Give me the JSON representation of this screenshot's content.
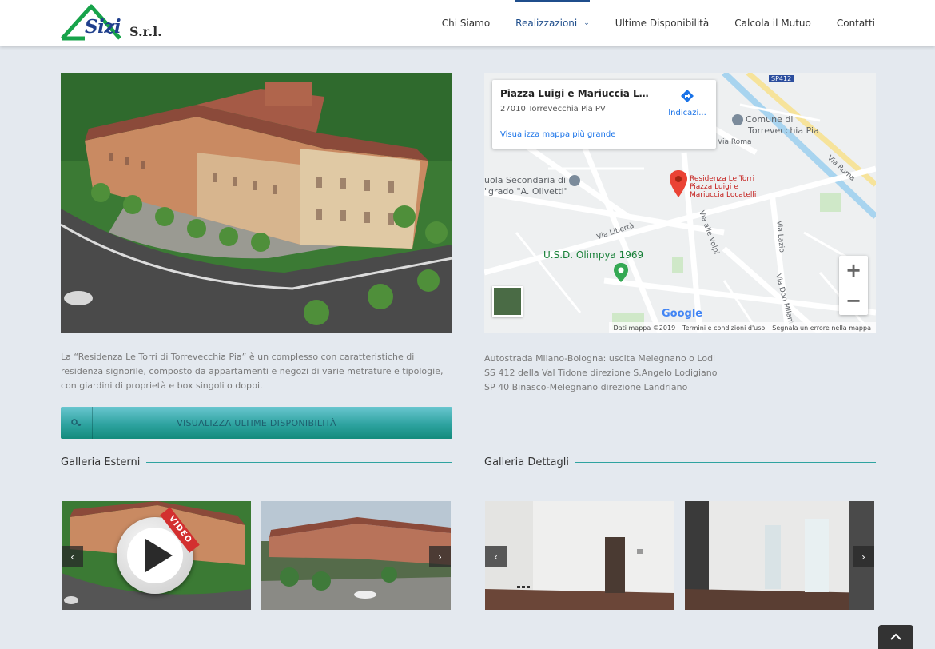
{
  "header": {
    "logo": {
      "brand": "Sizi",
      "suffix": "S.r.l."
    },
    "nav": [
      {
        "label": "Chi Siamo"
      },
      {
        "label": "Realizzazioni",
        "active": true
      },
      {
        "label": "Ultime Disponibilità"
      },
      {
        "label": "Calcola il Mutuo"
      },
      {
        "label": "Contatti"
      }
    ]
  },
  "main": {
    "description": "La “Residenza Le Torri di Torrevecchia Pia” è un complesso con caratteristiche di residenza signorile, composto da appartamenti e negozi di varie metrature e tipologie, con giardini di proprietà e box singoli o doppi.",
    "cta_label": "VISUALIZZA ULTIME DISPONIBILITÀ"
  },
  "map": {
    "card": {
      "title": "Piazza Luigi e Mariuccia Loca...",
      "address": "27010 Torrevecchia Pia PV",
      "link": "Visualizza mappa più grande",
      "directions": "Indicazi..."
    },
    "labels": {
      "comune": [
        "Comune di",
        "Torrevecchia Pia"
      ],
      "scuola": [
        "uola Secondaria di",
        "\"grado \"A. Olivetti\""
      ],
      "pin": [
        "Residenza Le Torri",
        "Piazza Luigi e",
        "Mariuccia Locatelli"
      ],
      "olimpya": "U.S.D. Olimpya 1969",
      "via_roma": "Via Roma",
      "via_roma2": "Via Roma",
      "via_liberta": "Via Libertà",
      "via_volpi": "Via alle Volpi",
      "via_lazio": "Via Lazio",
      "via_don_milani": "Via Don Milani",
      "sp412": "SP412"
    },
    "footer": {
      "data": "Dati mappa ©2019",
      "terms": "Termini e condizioni d'uso",
      "report": "Segnala un errore nella mappa"
    },
    "google": "Google"
  },
  "directions": [
    "Autostrada Milano-Bologna: uscita Melegnano o Lodi",
    "SS 412 della Val Tidone direzione S.Angelo Lodigiano",
    "SP 40 Binasco-Melegnano direzione Landriano"
  ],
  "galleries": {
    "esterni": {
      "title": "Galleria Esterni",
      "video_badge": "VIDEO"
    },
    "dettagli": {
      "title": "Galleria Dettagli"
    }
  },
  "colors": {
    "accent": "#2ea3a0",
    "nav_active": "#1f4e8c",
    "logo_green": "#17a34a",
    "logo_blue": "#1f3f8c"
  }
}
